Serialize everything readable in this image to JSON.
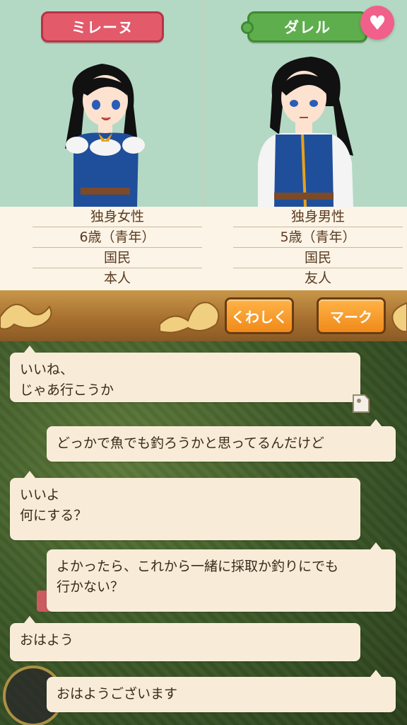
{
  "characters": {
    "left": {
      "name": "ミレーヌ",
      "info": [
        "独身女性",
        "6歳（青年）",
        "国民",
        "本人"
      ]
    },
    "right": {
      "name": "ダレル",
      "info": [
        "独身男性",
        "5歳（青年）",
        "国民",
        "友人"
      ]
    }
  },
  "actions": {
    "detail_label": "くわしく",
    "mark_label": "マーク"
  },
  "chat": [
    {
      "side": "left",
      "text": "いいね、\nじゃあ行こうか"
    },
    {
      "side": "right",
      "text": "どっかで魚でも釣ろうかと思ってるんだけど"
    },
    {
      "side": "left",
      "text": "いいよ\n何にする？"
    },
    {
      "side": "right",
      "text": "よかったら、これから一緒に採取か釣りにでも\n行かない？"
    },
    {
      "side": "left",
      "text": "おはよう"
    },
    {
      "side": "right",
      "text": "おはようございます"
    }
  ],
  "icons": {
    "heart": "heart-icon",
    "bookmark": "bookmark-icon"
  },
  "colors": {
    "left_tag": "#e35a6a",
    "right_tag": "#5fae4e",
    "heart_button": "#f0608a",
    "action_button": "#f08a1a",
    "bubble": "#f8ecd8"
  }
}
